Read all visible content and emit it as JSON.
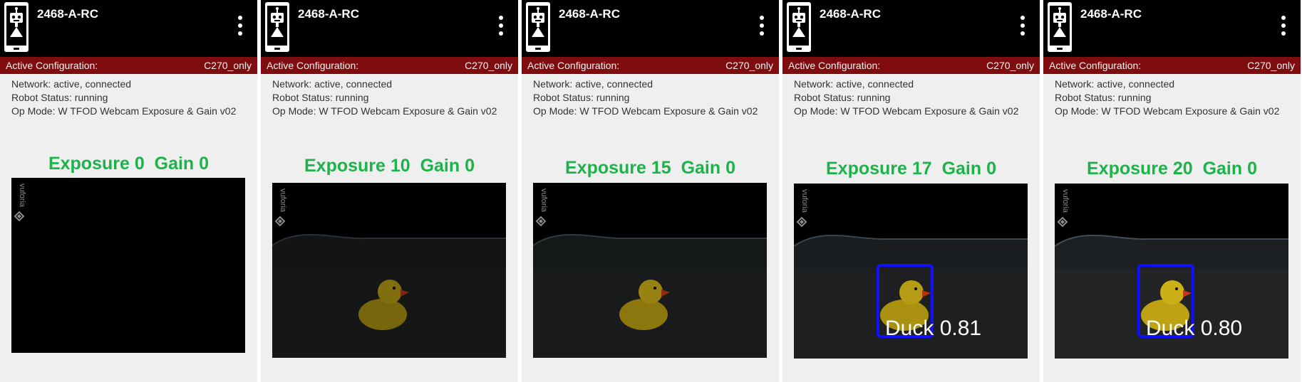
{
  "panels": [
    {
      "robot_name": "2468-A-RC",
      "config_label": "Active Configuration:",
      "config_value": "C270_only",
      "network": "Network: active, connected",
      "robot_status": "Robot Status: running",
      "op_mode": "Op Mode: W TFOD Webcam Exposure & Gain v02",
      "caption": "Exposure 0  Gain 0",
      "camera_brightness": 0,
      "detection": null
    },
    {
      "robot_name": "2468-A-RC",
      "config_label": "Active Configuration:",
      "config_value": "C270_only",
      "network": "Network: active, connected",
      "robot_status": "Robot Status: running",
      "op_mode": "Op Mode: W TFOD Webcam Exposure & Gain v02",
      "caption": "Exposure 10  Gain 0",
      "camera_brightness": 0.6,
      "detection": null
    },
    {
      "robot_name": "2468-A-RC",
      "config_label": "Active Configuration:",
      "config_value": "C270_only",
      "network": "Network: active, connected",
      "robot_status": "Robot Status: running",
      "op_mode": "Op Mode: W TFOD Webcam Exposure & Gain v02",
      "caption": "Exposure 15  Gain 0",
      "camera_brightness": 0.7,
      "detection": null
    },
    {
      "robot_name": "2468-A-RC",
      "config_label": "Active Configuration:",
      "config_value": "C270_only",
      "network": "Network: active, connected",
      "robot_status": "Robot Status: running",
      "op_mode": "Op Mode: W TFOD Webcam Exposure & Gain v02",
      "caption": "Exposure 17  Gain 0",
      "camera_brightness": 0.85,
      "detection": {
        "label": "Duck",
        "confidence": "0.81"
      }
    },
    {
      "robot_name": "2468-A-RC",
      "config_label": "Active Configuration:",
      "config_value": "C270_only",
      "network": "Network: active, connected",
      "robot_status": "Robot Status: running",
      "op_mode": "Op Mode: W TFOD Webcam Exposure & Gain v02",
      "caption": "Exposure 20  Gain 0",
      "camera_brightness": 0.95,
      "detection": {
        "label": "Duck",
        "confidence": "0.80"
      }
    }
  ],
  "icons": {
    "robot": "robot-phone-icon",
    "menu": "overflow-menu-icon",
    "watermark": "vuforia-watermark",
    "watermark_text": "vuforia"
  },
  "colors": {
    "topbar": "#000000",
    "configbar": "#7f0d0f",
    "caption": "#1db34a",
    "detection_box": "#1010ff"
  }
}
